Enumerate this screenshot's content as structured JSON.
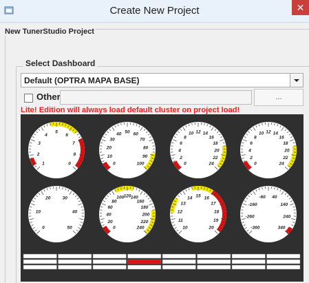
{
  "window": {
    "title": "Create New Project",
    "close_glyph": "✕",
    "icon": "app-icon"
  },
  "group": {
    "legend": "New TunerStudio Project"
  },
  "dashboard": {
    "legend": "Select Dashboard",
    "selected": "Default (OPTRA MAPA BASE)",
    "other_label": "Other",
    "other_checked": false,
    "browse_label": "...",
    "warning": "Lite! Edition will always load default cluster on project load!",
    "warning_color": "#ff1a1a"
  },
  "preview": {
    "background": "#2f2f2f",
    "gauges": [
      {
        "labels": [
          "1",
          "2",
          "3",
          "4",
          "5",
          "6",
          "7",
          "8",
          "0"
        ]
      },
      {
        "labels": [
          "0",
          "10",
          "20",
          "30",
          "40",
          "50",
          "60",
          "70",
          "80",
          "90",
          "100"
        ]
      },
      {
        "labels": [
          "0",
          "2",
          "4",
          "6",
          "8",
          "10",
          "12",
          "14",
          "16",
          "18",
          "20",
          "22",
          "24"
        ]
      },
      {
        "labels": [
          "0",
          "2",
          "4",
          "6",
          "8",
          "10",
          "12",
          "14",
          "16",
          "18",
          "20",
          "22",
          "24"
        ]
      },
      {
        "labels": [
          "0",
          "10",
          "20",
          "30",
          "40",
          "50"
        ]
      },
      {
        "labels": [
          "0",
          "20",
          "40",
          "60",
          "80",
          "100",
          "120",
          "140",
          "160",
          "180",
          "200",
          "220",
          "240"
        ]
      },
      {
        "labels": [
          "10",
          "11",
          "12",
          "13",
          "14",
          "15",
          "16",
          "17",
          "18",
          "19",
          "20"
        ]
      },
      {
        "labels": [
          "-360",
          "-260",
          "-160",
          "-60",
          "40",
          "140",
          "240",
          "340"
        ]
      }
    ]
  }
}
